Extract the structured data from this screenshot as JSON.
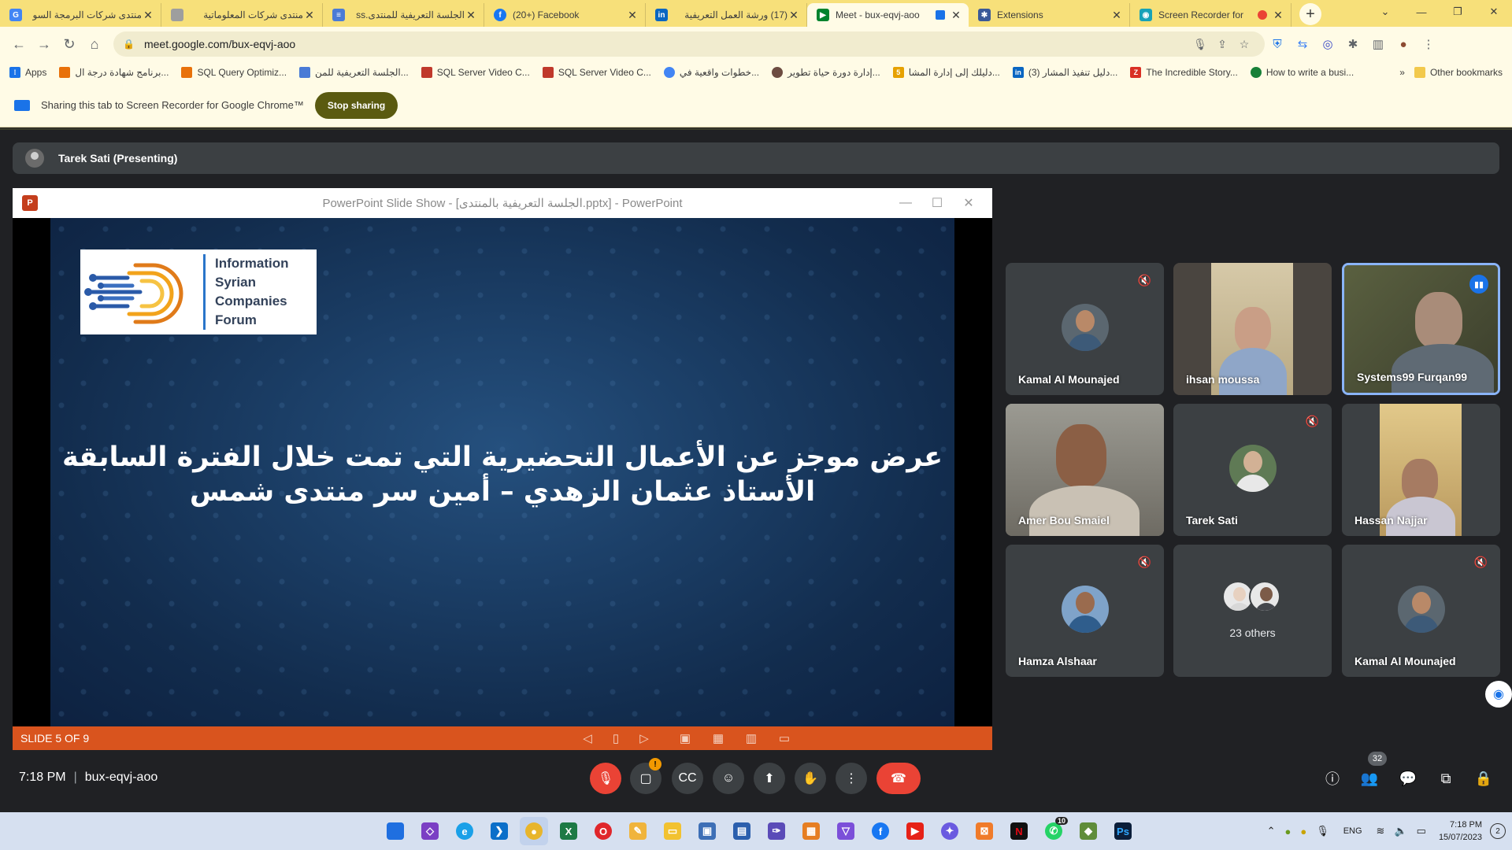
{
  "browser": {
    "tabs": [
      {
        "title": "منتدى شركات البرمجة السو",
        "fav_color": "#4285f4",
        "fav_letter": "G"
      },
      {
        "title": "منتدى شركات المعلوماتية",
        "fav_color": "#9e9e9e",
        "fav_letter": ""
      },
      {
        "title": "الجلسة التعريفية للمنتدى.ss",
        "fav_color": "#4a7bd6",
        "fav_letter": "≡"
      },
      {
        "title": "(20+) Facebook",
        "fav_color": "#1877f2",
        "fav_letter": "f"
      },
      {
        "title": "(17) ورشة العمل التعريفية",
        "fav_color": "#0a66c2",
        "fav_letter": "in"
      },
      {
        "title": "Meet - bux-eqvj-aoo",
        "fav_color": "#00832d",
        "fav_letter": "▶"
      },
      {
        "title": "Extensions",
        "fav_color": "#3b5998",
        "fav_letter": "✱"
      },
      {
        "title": "Screen Recorder for",
        "fav_color": "#17a2b8",
        "fav_letter": "◉"
      }
    ],
    "url": "meet.google.com/bux-eqvj-aoo",
    "bookmarks": [
      {
        "label": "Apps",
        "color": "#1a73e8"
      },
      {
        "label": "برنامج شهادة درجة ال...",
        "color": "#e8710a"
      },
      {
        "label": "SQL Query Optimiz...",
        "color": "#e8710a"
      },
      {
        "label": "الجلسة التعريفية للمن...",
        "color": "#4a7bd6"
      },
      {
        "label": "SQL Server Video C...",
        "color": "#c0392b"
      },
      {
        "label": "SQL Server Video C...",
        "color": "#c0392b"
      },
      {
        "label": "خطوات واقعية في...",
        "color": "#4285f4"
      },
      {
        "label": "إدارة دورة حياة تطوير...",
        "color": "#6d4c41"
      },
      {
        "label": "دليلك إلى إدارة المشا...",
        "color": "#e6a100"
      },
      {
        "label": "(3) دليل تنفيذ المشار...",
        "color": "#0a66c2"
      },
      {
        "label": "The Incredible Story...",
        "color": "#d93025"
      },
      {
        "label": "How to write a busi...",
        "color": "#188038"
      }
    ],
    "bookmarks_more": "»",
    "other_bookmarks": "Other bookmarks"
  },
  "infobar": {
    "message": "Sharing this tab to Screen Recorder for Google Chrome™",
    "stop_label": "Stop sharing"
  },
  "meet": {
    "presenter": "Tarek Sati (Presenting)",
    "ppt": {
      "window_title": "PowerPoint Slide Show - [الجلسة التعريفية بالمنتدى.pptx] - PowerPoint",
      "logo_text": [
        "Information",
        "Syrian",
        "Companies",
        "Forum"
      ],
      "slide_line1": "عرض موجز عن الأعمال التحضيرية التي تمت خلال الفترة السابقة",
      "slide_line2": "الأستاذ عثمان الزهدي – أمين سر منتدى شمس",
      "status": "SLIDE 5 OF 9"
    },
    "participants": [
      {
        "name": "Kamal Al Mounajed"
      },
      {
        "name": "ihsan moussa"
      },
      {
        "name": "Systems99 Furqan99"
      },
      {
        "name": "Amer Bou Smaiel"
      },
      {
        "name": "Tarek Sati"
      },
      {
        "name": "Hassan Najjar"
      },
      {
        "name": "Hamza Alshaar"
      },
      {
        "name": "Kamal Al Mounajed"
      }
    ],
    "others_label": "23 others",
    "time": "7:18 PM",
    "meeting_code": "bux-eqvj-aoo",
    "people_count": "32",
    "accent_end_call": "#ea4335"
  },
  "taskbar": {
    "lang": "ENG",
    "time": "7:18 PM",
    "date": "15/07/2023",
    "notifications": "2",
    "whatsapp_badge": "10"
  }
}
